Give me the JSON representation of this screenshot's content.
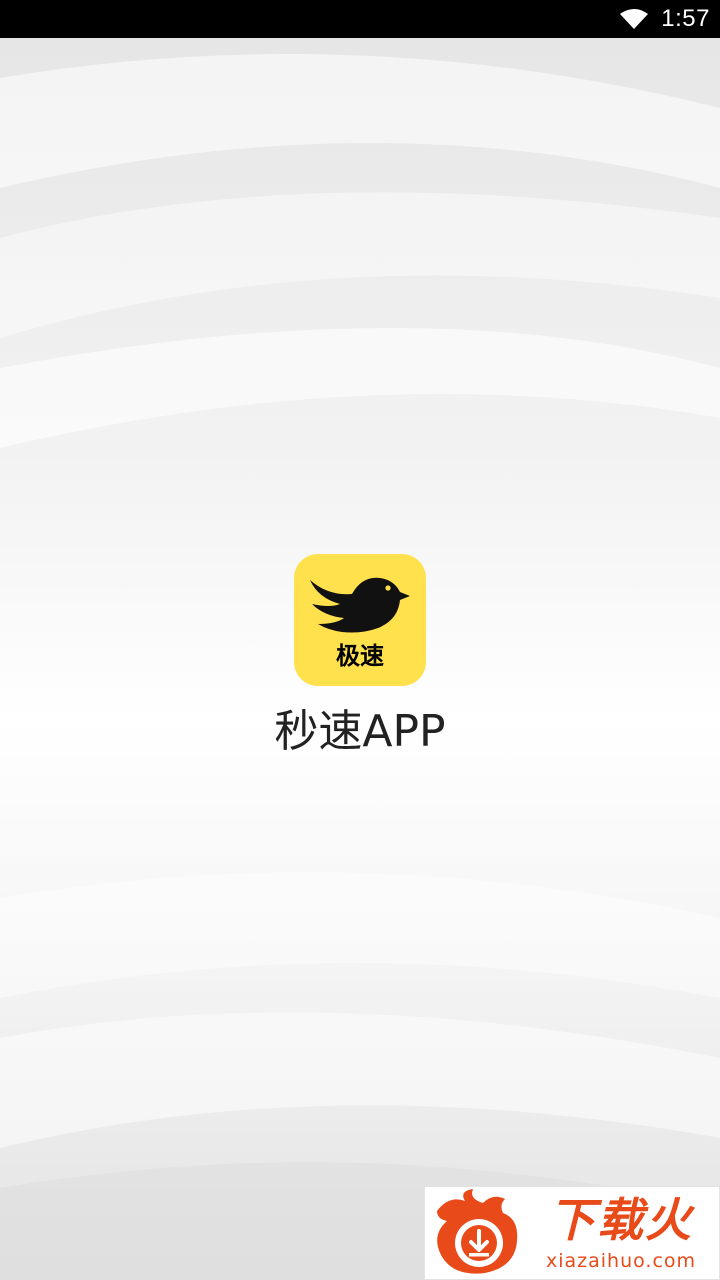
{
  "status_bar": {
    "time": "1:57",
    "icons": [
      "wifi-icon"
    ]
  },
  "splash": {
    "icon_label": "极速",
    "app_name": "秒速APP",
    "icon_color": "#ffe14d"
  },
  "watermark": {
    "title": "下载火",
    "domain": "xiazaihuo.com",
    "color": "#e84a1a"
  }
}
